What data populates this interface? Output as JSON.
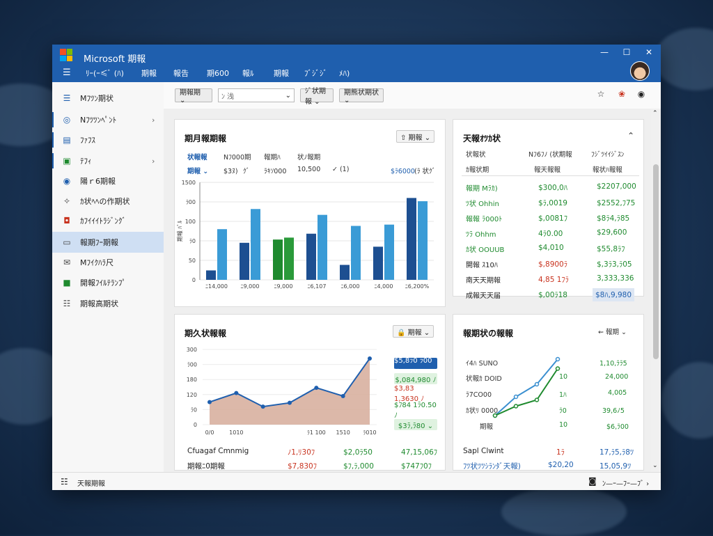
{
  "app": {
    "title": "Microsoft 期報",
    "logo_colors": [
      "#f25022",
      "#7fba00",
      "#00a4ef",
      "#ffb900"
    ],
    "window_controls": [
      "—",
      "☐",
      "✕"
    ]
  },
  "menu": [
    "ﾘｰ(ｰ≤ﾞ (ﾊ)",
    "期報",
    "報告",
    "期600",
    "報ﾙ",
    "期報",
    "ﾌﾞｼﾞｼﾞ",
    "ﾒﾊ)"
  ],
  "sidebar": {
    "items": [
      {
        "label": "Mﾌﾂﾝ期状",
        "icon": "stack-icon",
        "chevron": ""
      },
      {
        "label": "Nﾌﾂﾂﾝﾍﾟﾝﾄ",
        "icon": "circle-icon",
        "chevron": "›"
      },
      {
        "label": "ﾌｧﾌｽ",
        "icon": "document-icon",
        "chevron": ""
      },
      {
        "label": "ﾃﾌｨ",
        "icon": "list-icon",
        "chevron": "›"
      },
      {
        "label": "陽ｒ6期報",
        "icon": "record-icon",
        "chevron": ""
      },
      {
        "label": "ｶ状ﾍﾍの作期状",
        "icon": "map-icon",
        "chevron": ""
      },
      {
        "label": "ｶﾌｲｲｲﾄﾗｼﾞﾝｸﾞ",
        "icon": "shield-icon",
        "chevron": ""
      },
      {
        "label": "報期ﾌｰ期報",
        "icon": "report-icon",
        "chevron": ""
      },
      {
        "label": "Mﾌｲｸﾊﾗ尺",
        "icon": "mail-icon",
        "chevron": ""
      },
      {
        "label": "開報ﾌｲﾙﾃﾗﾝﾌﾟ",
        "icon": "folder-icon",
        "chevron": ""
      },
      {
        "label": "期報高期状",
        "icon": "grid-icon",
        "chevron": ""
      }
    ],
    "active_index": 7
  },
  "toolbar": {
    "btn1": "期報期 ⌄",
    "search_placeholder": "ﾝ 浅",
    "search_chevron": "⌄",
    "btn2": "ｼﾞ状期報 ⌄",
    "btn3": "期熊状期状 ⌄"
  },
  "panel1": {
    "title": "期月報期報",
    "button": "⇧ 期報 ⌄",
    "filters": [
      "状報報",
      "Nﾌ000期",
      "報期ﾊ",
      "状ﾉ報期"
    ],
    "subvals": [
      "期報 ⌄",
      "$3ﾇ)",
      "ｸﾞ",
      "ﾗｷｿ000",
      "10,500",
      "✓ (1)",
      "$ﾗ6000",
      "(ﾗ 状ｸﾞ"
    ],
    "ylabel": "期報 ﾊﾞﾙ"
  },
  "chart_data": [
    {
      "type": "bar",
      "categories": [
        "ﾆ14,000",
        "ﾆ9,000",
        "ﾆ9,000",
        "ﾆ6,107",
        "ﾆ6,000",
        "ﾆ4,000",
        "ﾆ6,200%"
      ],
      "series": [
        {
          "color": "#1d4f91",
          "values": [
            145,
            570,
            620,
            710,
            230,
            510,
            1260
          ]
        },
        {
          "color": "#3a9bd6",
          "values": [
            780,
            1090,
            650,
            1000,
            830,
            850,
            1210
          ]
        }
      ],
      "series_colors_override": [
        {
          "index": 2,
          "colors": [
            "#1e8a2e",
            "#2a9a3a"
          ]
        }
      ],
      "yticks": [
        "1500",
        "ﾗ00",
        "100",
        "ﾗ0",
        "50",
        "0"
      ],
      "ylim": [
        0,
        1500
      ],
      "grid": true
    },
    {
      "type": "area",
      "x": [
        "0/0",
        "1010",
        "",
        "",
        "ﾗ1 100",
        "1510",
        "ﾗ010"
      ],
      "values": [
        300,
        420,
        240,
        290,
        490,
        380,
        880
      ],
      "yticks": [
        "300",
        "ﾗ00",
        "180",
        "120",
        "ﾗ0",
        "0"
      ],
      "ylim": [
        0,
        1000
      ],
      "color": "#1f5fae",
      "fill": "#d6ac9a"
    },
    {
      "type": "line",
      "series": [
        {
          "color": "#3a8fd0",
          "values": [
            0,
            60,
            100,
            180
          ]
        },
        {
          "color": "#1e8a2e",
          "values": [
            0,
            30,
            50,
            150
          ]
        }
      ]
    }
  ],
  "panel2": {
    "title": "期久状報報",
    "button": "🔒 期報 ⌄",
    "chips": [
      "$5,8ﾗ0 ﾗ00 ⌄",
      "$,084,980 ﾉ",
      "$3,83 1,3630 ﾉ",
      "$ﾌ84 1ﾗ0.50 ﾉ",
      "$3ﾗ,ﾗ80 ⌄"
    ],
    "rows": [
      [
        "Cfuagaf Cmnmig",
        "ﾉ1,ﾘ30ﾌ",
        "$2,0ﾗ50",
        "47,15,06ﾌ"
      ],
      [
        "期報ﾆ0期報",
        "$7,830ﾌ",
        "$ﾌ,ﾗ,000",
        "$747ﾌ0ﾌ"
      ]
    ]
  },
  "panel3": {
    "title": "天報ｵﾂｶ状",
    "chevron": "⌃",
    "headers": [
      "状報状",
      "Nﾌ6ﾌﾉ (状期報",
      "ﾌｼﾞﾂｲｲｼﾞｽﾝ"
    ],
    "headers2": [
      "ｶ報状期",
      "報天報報",
      "報状ﾊ報報"
    ],
    "rows": [
      {
        "label": "報期 Mﾗｶ)",
        "v1": "$300,0ﾊ",
        "v2": "$2207,000",
        "c1": "green",
        "c2": "green"
      },
      {
        "label": "ﾂ状 Ohhin",
        "v1": "$ﾗ,0019",
        "v2": "$2552,ﾌ75",
        "c1": "green",
        "c2": "green"
      },
      {
        "label": "報報 ﾗ000ﾄ",
        "v1": "$,0081ﾌ",
        "v2": "$8ﾗ4,ﾗ85",
        "c1": "green",
        "c2": "green"
      },
      {
        "label": "ﾂﾗ Ohhm",
        "v1": "4ﾗ0.00",
        "v2": "$29,600",
        "c1": "green",
        "c2": "green"
      },
      {
        "label": "ｶ状 OOUUB",
        "v1": "$4,010",
        "v2": "$55,8ﾗﾌ",
        "c1": "green",
        "c2": "green"
      },
      {
        "label": "開報 ｽ10ﾊ",
        "v1": "$,8900ﾗ",
        "v2": "$,3ﾗ3,ﾗ05",
        "c1": "red",
        "c2": "green"
      },
      {
        "label": "南天天期報",
        "v1": "4,85 1ﾌﾗ",
        "v2": "3,333,336",
        "c1": "red",
        "c2": "green"
      },
      {
        "label": "成報天天届",
        "v1": "$,00ﾗ18",
        "v2": "$8ﾊ,9,980",
        "c1": "green",
        "c2": "blue"
      }
    ]
  },
  "panel4": {
    "title": "報期状の報報",
    "button": "⇜ 報期 ⌄",
    "labels": [
      "ｲ4ﾊ SUNO",
      "状報ｶ DOID",
      "ﾗ7CO00",
      "ｶ状ﾘ 0000",
      "期報"
    ],
    "mid": [
      "",
      "10",
      "1ﾊ",
      "ﾗ0",
      "10"
    ],
    "vals": [
      "1,10,ﾗﾗ5",
      "24,000",
      "4,005",
      "39,6ﾉ5",
      "$6,ﾗ00"
    ],
    "summary_rows": [
      [
        "Sapl Clwint",
        "1ﾗ",
        "17,ﾗ5,ﾗ8ﾂ"
      ],
      [
        "ﾌﾂ状ﾂﾂｼﾗﾝﾀﾞ天報)",
        "$20,20",
        "15,05,9ﾂ"
      ]
    ]
  },
  "statusbar": {
    "left": "天報期報",
    "right": "ﾝ—ｰ—ﾌｰ—ﾌﾞ ›"
  }
}
